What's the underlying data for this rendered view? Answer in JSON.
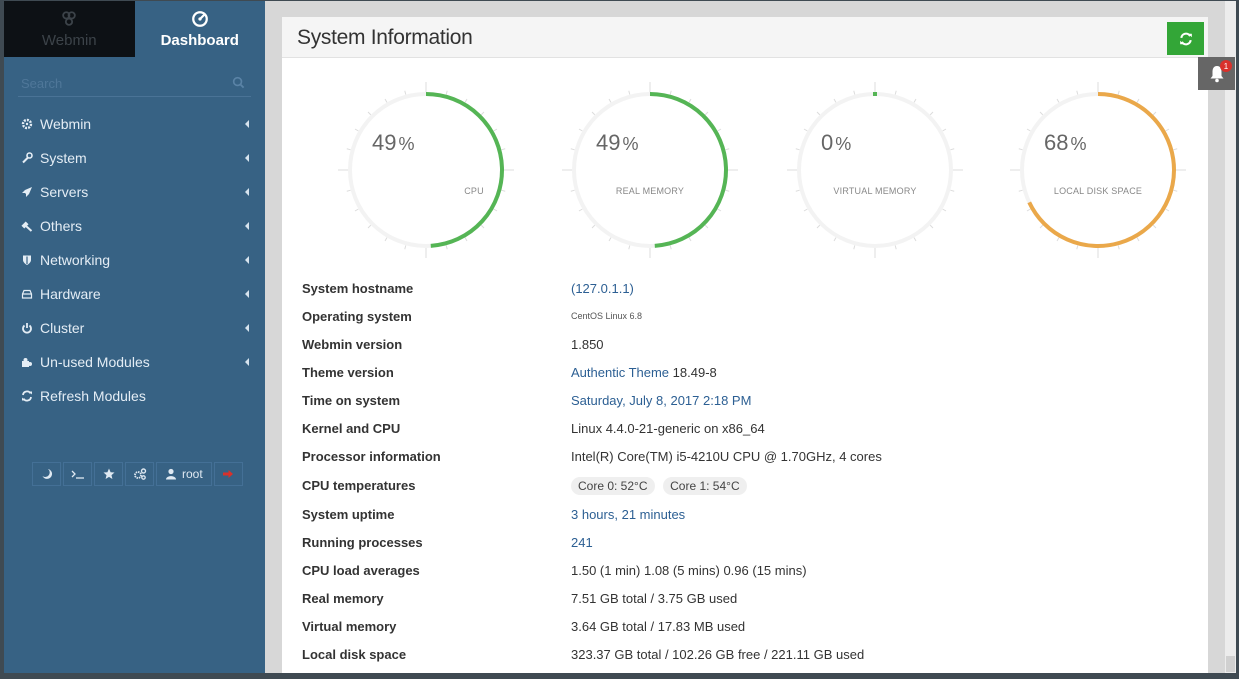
{
  "sidebar": {
    "switch": {
      "webmin_label": "Webmin",
      "dashboard_label": "Dashboard",
      "active": "dashboard"
    },
    "search": {
      "placeholder": "Search",
      "value": ""
    },
    "menu": [
      {
        "label": "Webmin",
        "icon": "gear-icon",
        "has_submenu": true
      },
      {
        "label": "System",
        "icon": "wrench-icon",
        "has_submenu": true
      },
      {
        "label": "Servers",
        "icon": "rocket-icon",
        "has_submenu": true
      },
      {
        "label": "Others",
        "icon": "gavel-icon",
        "has_submenu": true
      },
      {
        "label": "Networking",
        "icon": "shield-icon",
        "has_submenu": true
      },
      {
        "label": "Hardware",
        "icon": "hdd-icon",
        "has_submenu": true
      },
      {
        "label": "Cluster",
        "icon": "power-icon",
        "has_submenu": true
      },
      {
        "label": "Un-used Modules",
        "icon": "puzzle-icon",
        "has_submenu": true
      },
      {
        "label": "Refresh Modules",
        "icon": "refresh-icon",
        "has_submenu": false
      }
    ],
    "toolbar": {
      "user_label": "root",
      "buttons": [
        "night-mode",
        "terminal",
        "favorites",
        "settings",
        "user",
        "logout"
      ]
    }
  },
  "panel": {
    "title": "System Information",
    "notifications_count": "1"
  },
  "gauges": [
    {
      "value": "49",
      "unit": "%",
      "label": "CPU",
      "fraction": 0.49,
      "color": "#55b555"
    },
    {
      "value": "49",
      "unit": "%",
      "label": "REAL MEMORY",
      "fraction": 0.49,
      "color": "#55b555"
    },
    {
      "value": "0",
      "unit": "%",
      "label": "VIRTUAL MEMORY",
      "fraction": 0.0,
      "color": "#55b555"
    },
    {
      "value": "68",
      "unit": "%",
      "label": "LOCAL DISK SPACE",
      "fraction": 0.68,
      "color": "#eaa84a"
    }
  ],
  "info": {
    "hostname": {
      "label": "System hostname",
      "value": "(127.0.1.1)"
    },
    "os": {
      "label": "Operating system",
      "value": "CentOS Linux 6.8"
    },
    "webmin_version": {
      "label": "Webmin version",
      "value": "1.850"
    },
    "theme_version": {
      "label": "Theme version",
      "link": "Authentic Theme",
      "value": "18.49-8"
    },
    "time": {
      "label": "Time on system",
      "value": "Saturday, July 8, 2017 2:18 PM"
    },
    "kernel": {
      "label": "Kernel and CPU",
      "value": "Linux 4.4.0-21-generic on x86_64"
    },
    "processor": {
      "label": "Processor information",
      "value": "Intel(R) Core(TM) i5-4210U CPU @ 1.70GHz, 4 cores"
    },
    "temps": {
      "label": "CPU temperatures",
      "values": [
        "Core 0: 52°C",
        "Core 1: 54°C"
      ]
    },
    "uptime": {
      "label": "System uptime",
      "value": "3 hours, 21 minutes"
    },
    "processes": {
      "label": "Running processes",
      "value": "241"
    },
    "load": {
      "label": "CPU load averages",
      "value": "1.50 (1 min) 1.08 (5 mins) 0.96 (15 mins)"
    },
    "real_memory": {
      "label": "Real memory",
      "value": "7.51 GB total / 3.75 GB used"
    },
    "virtual_memory": {
      "label": "Virtual memory",
      "value": "3.64 GB total / 17.83 MB used"
    },
    "disk": {
      "label": "Local disk space",
      "value": "323.37 GB total / 102.26 GB free / 221.11 GB used"
    }
  }
}
